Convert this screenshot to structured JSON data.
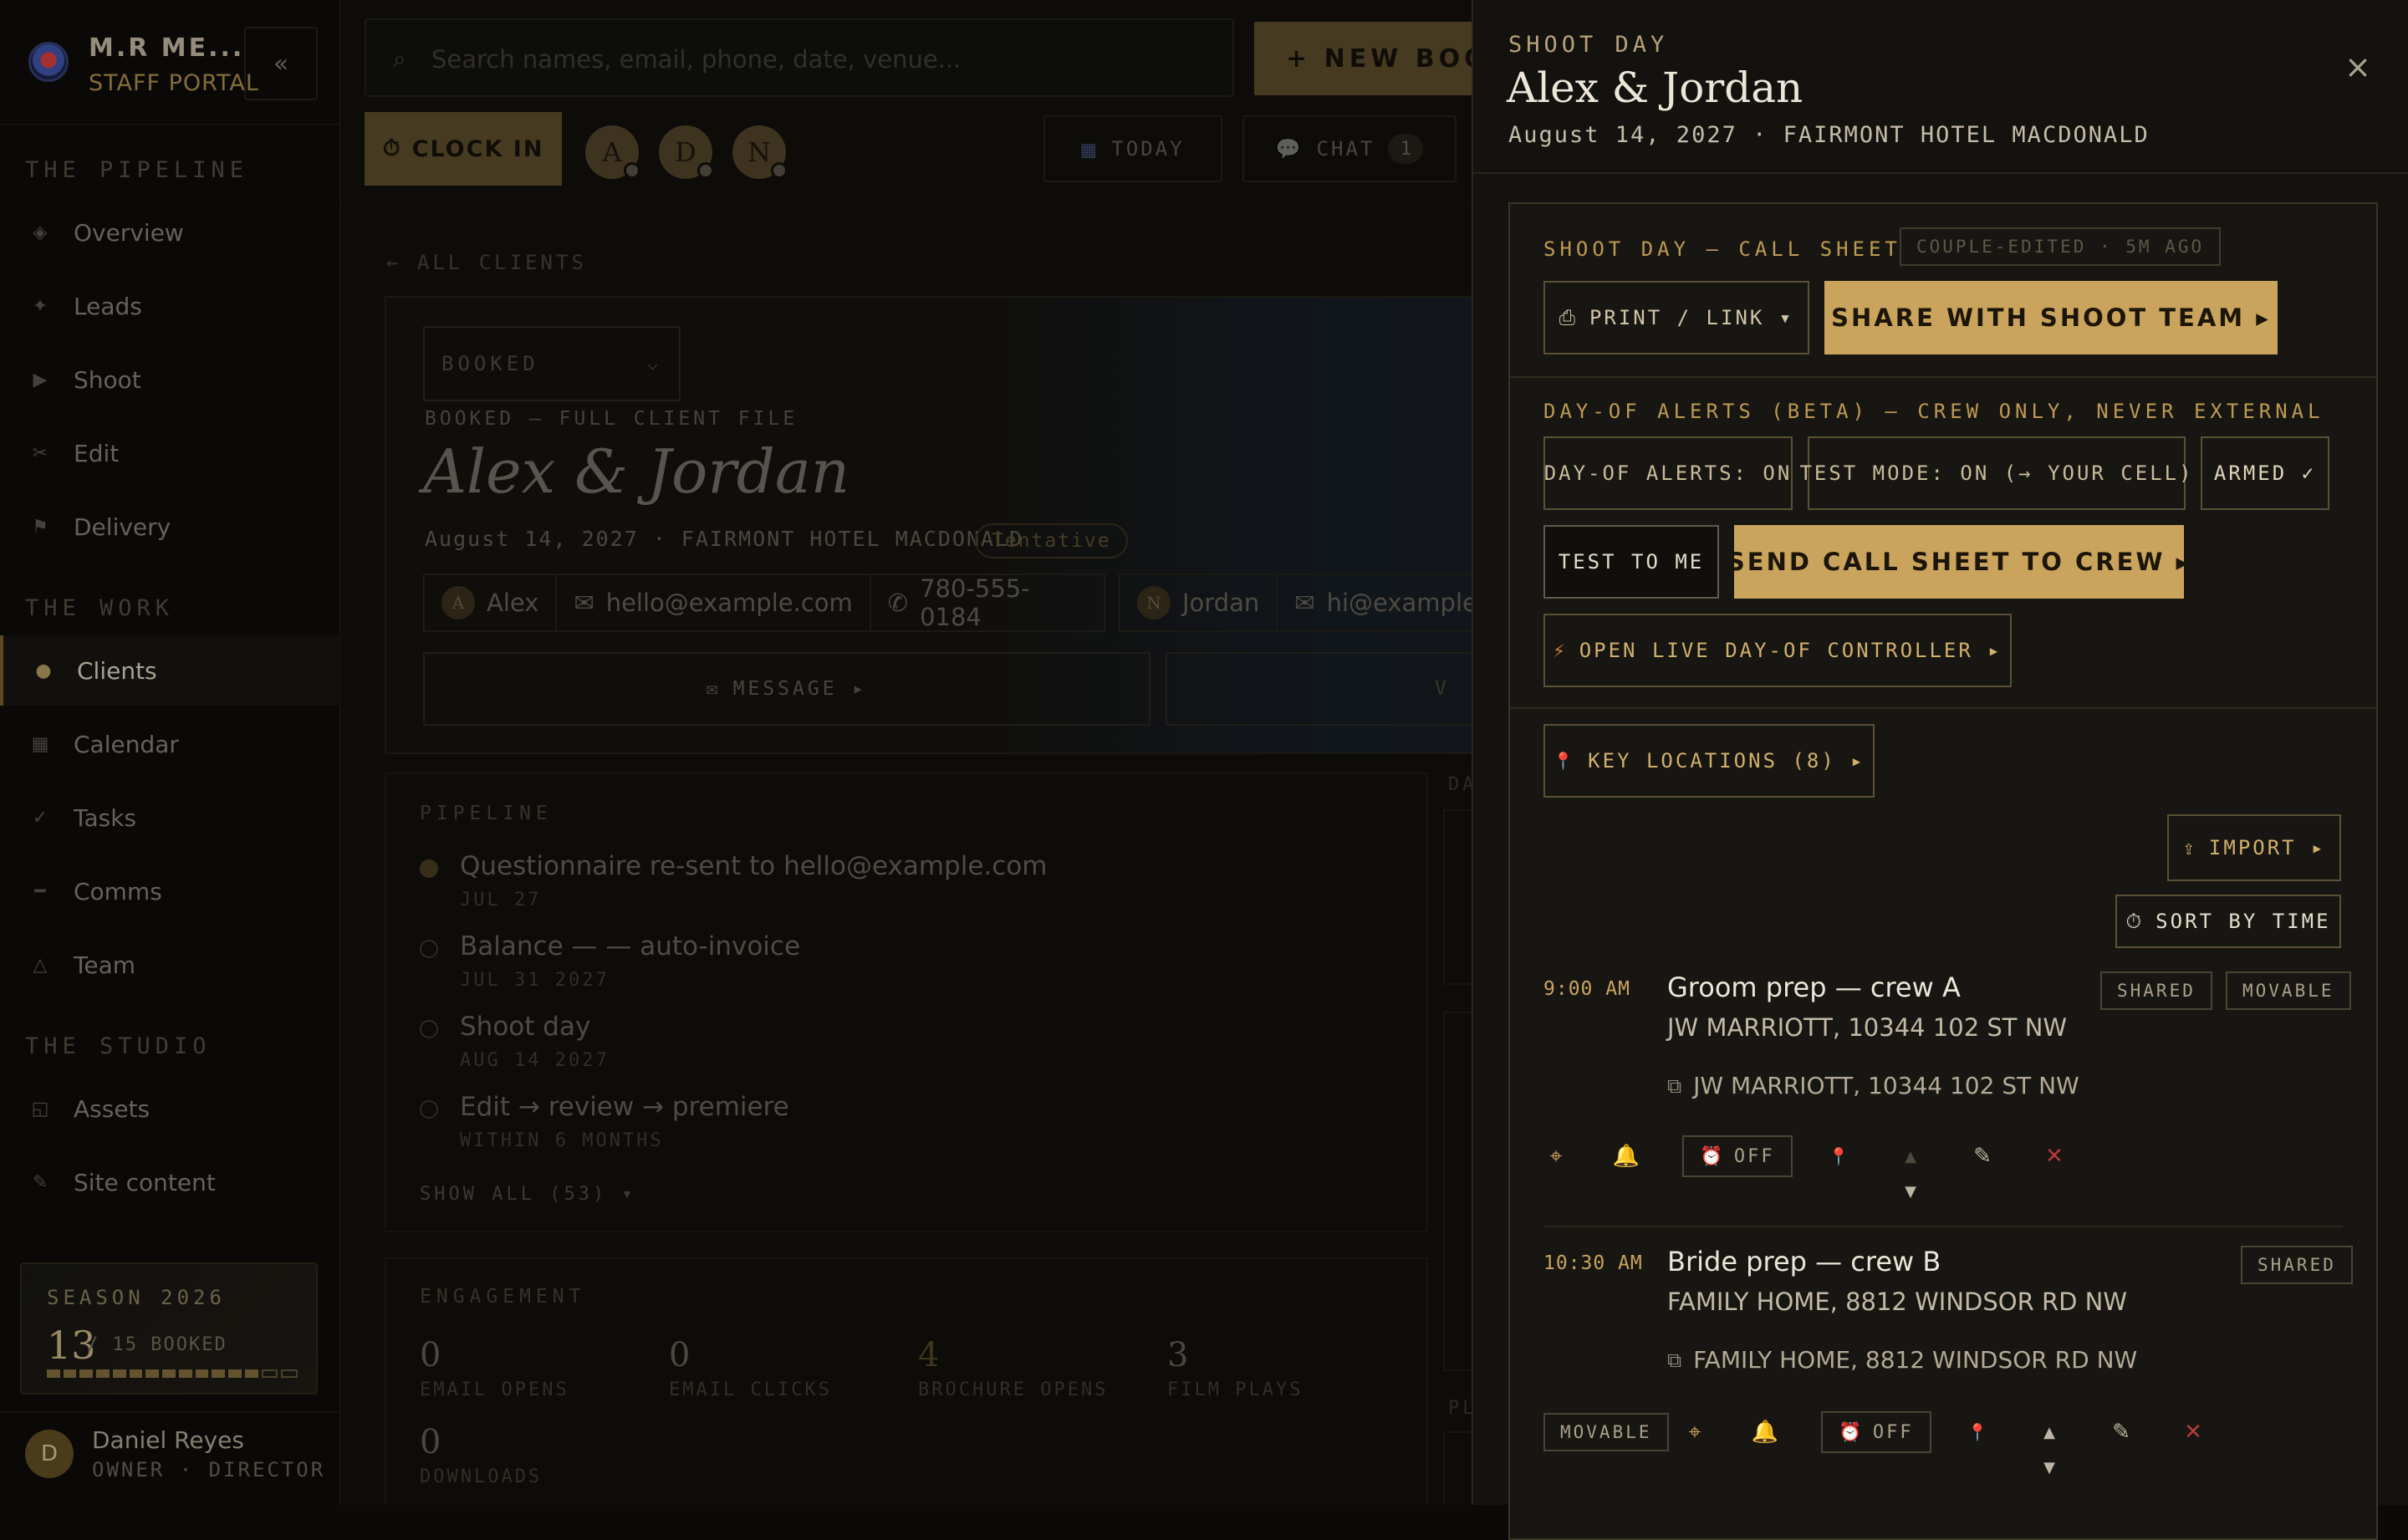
{
  "sidebar": {
    "brand_name": "M.R ME...",
    "brand_sub": "STAFF PORTAL",
    "collapse_label": "«",
    "sections": {
      "pipeline": "THE PIPELINE",
      "work": "THE WORK",
      "studio": "THE STUDIO"
    },
    "items": [
      {
        "label": "Overview",
        "icon": "◈"
      },
      {
        "label": "Leads",
        "icon": "✦"
      },
      {
        "label": "Shoot",
        "icon": "▶"
      },
      {
        "label": "Edit",
        "icon": "✂"
      },
      {
        "label": "Delivery",
        "icon": "⚑"
      },
      {
        "label": "Clients",
        "icon": "●"
      },
      {
        "label": "Calendar",
        "icon": "▦"
      },
      {
        "label": "Tasks",
        "icon": "✓"
      },
      {
        "label": "Comms",
        "icon": "━"
      },
      {
        "label": "Team",
        "icon": "△"
      },
      {
        "label": "Assets",
        "icon": "◱"
      },
      {
        "label": "Site content",
        "icon": "✎"
      }
    ],
    "season": {
      "title": "SEASON 2026",
      "booked": "13",
      "of_label": "/ 15 BOOKED",
      "progress_filled": 13,
      "progress_total": 15
    },
    "user": {
      "initial": "D",
      "name": "Daniel Reyes",
      "role": "OWNER · DIRECTOR"
    }
  },
  "topbar": {
    "search_placeholder": "Search names, email, phone, date, venue...",
    "new_booking": "+ NEW BOOKING",
    "clock_in": "CLOCK IN",
    "presence": [
      "A",
      "D",
      "N"
    ],
    "today": "TODAY",
    "chat": "CHAT",
    "chat_count": "1"
  },
  "client": {
    "back": "← ALL CLIENTS",
    "status": "BOOKED",
    "kicker": "BOOKED — FULL CLIENT FILE",
    "title": "Alex & Jordan",
    "date_venue": "August 14, 2027 · FAIRMONT HOTEL MACDONALD",
    "tag": "Tentative",
    "contacts": [
      {
        "initial": "A",
        "name": "Alex",
        "email": "hello@example.com",
        "phone": "780-555-0184"
      },
      {
        "initial": "N",
        "name": "Jordan",
        "email": "hi@example.com"
      }
    ],
    "message_btn": "MESSAGE ▸",
    "second_btn": "V"
  },
  "pipeline": {
    "heading": "PIPELINE",
    "items": [
      {
        "text": "Questionnaire re-sent to hello@example.com",
        "date": "JUL 27",
        "done": true
      },
      {
        "text": "Balance — — auto-invoice",
        "date": "JUL 31 2027",
        "done": false
      },
      {
        "text": "Shoot day",
        "date": "AUG 14 2027",
        "done": false
      },
      {
        "text": "Edit → review → premiere",
        "date": "WITHIN 6 MONTHS",
        "done": false
      }
    ],
    "show_all": "SHOW ALL (53) ▾"
  },
  "engagement": {
    "heading": "ENGAGEMENT",
    "stats": [
      {
        "value": "0",
        "label": "EMAIL OPENS"
      },
      {
        "value": "0",
        "label": "EMAIL CLICKS"
      },
      {
        "value": "4",
        "label": "BROCHURE OPENS"
      },
      {
        "value": "3",
        "label": "FILM PLAYS"
      },
      {
        "value": "0",
        "label": "DOWNLOADS"
      }
    ]
  },
  "right_col_labels": {
    "first": "DA",
    "second": "PL"
  },
  "drawer": {
    "kicker": "SHOOT DAY",
    "title": "Alex & Jordan",
    "subtitle": "August 14, 2027 · FAIRMONT HOTEL MACDONALD",
    "close": "×",
    "call_sheet": {
      "heading": "SHOOT DAY — CALL SHEET",
      "edited_badge": "COUPLE-EDITED · 5M AGO",
      "print_btn": "PRINT / LINK ▾",
      "share_btn": "SHARE WITH SHOOT TEAM ▸"
    },
    "alerts": {
      "heading": "DAY-OF ALERTS (BETA) — CREW ONLY, NEVER EXTERNAL",
      "alerts_on": "DAY-OF ALERTS: ON",
      "test_mode": "TEST MODE: ON (→ YOUR CELL)",
      "armed": "ARMED ✓",
      "test_to_me": "TEST TO ME",
      "send_btn": "SEND CALL SHEET TO CREW ▸",
      "live_btn": "OPEN LIVE DAY-OF CONTROLLER ▸"
    },
    "locations_btn": "KEY LOCATIONS (8) ▸",
    "import_btn": "IMPORT ▸",
    "sort_btn": "SORT BY TIME",
    "events": [
      {
        "time": "9:00 AM",
        "name": "Groom prep — crew A",
        "address": "JW MARRIOTT, 10344 102 ST NW",
        "linked": "JW MARRIOTT, 10344 102 ST NW",
        "tags": [
          "SHARED",
          "MOVABLE"
        ],
        "alarm": "OFF"
      },
      {
        "time": "10:30 AM",
        "name": "Bride prep — crew B",
        "address": "FAMILY HOME, 8812 WINDSOR RD NW",
        "linked": "FAMILY HOME, 8812 WINDSOR RD NW",
        "tags": [
          "SHARED"
        ],
        "movable": "MOVABLE",
        "alarm": "OFF"
      }
    ]
  },
  "icons": {
    "search": "⌕",
    "clock": "⏱",
    "calendar": "▦",
    "chat": "💬",
    "mail": "✉",
    "phone": "✆",
    "printer": "⎙",
    "bolt": "⚡",
    "pin": "📍",
    "upload": "⇪",
    "stopwatch": "⏱",
    "link": "⧉",
    "target": "⌖",
    "bell": "🔔",
    "alarm": "⏰",
    "up": "▲",
    "down": "▼",
    "edit": "✎",
    "delete": "✕",
    "chevron": "⌵"
  },
  "colors": {
    "gold": "#caa45c",
    "danger": "#b63a3a",
    "bg": "#14120f"
  }
}
